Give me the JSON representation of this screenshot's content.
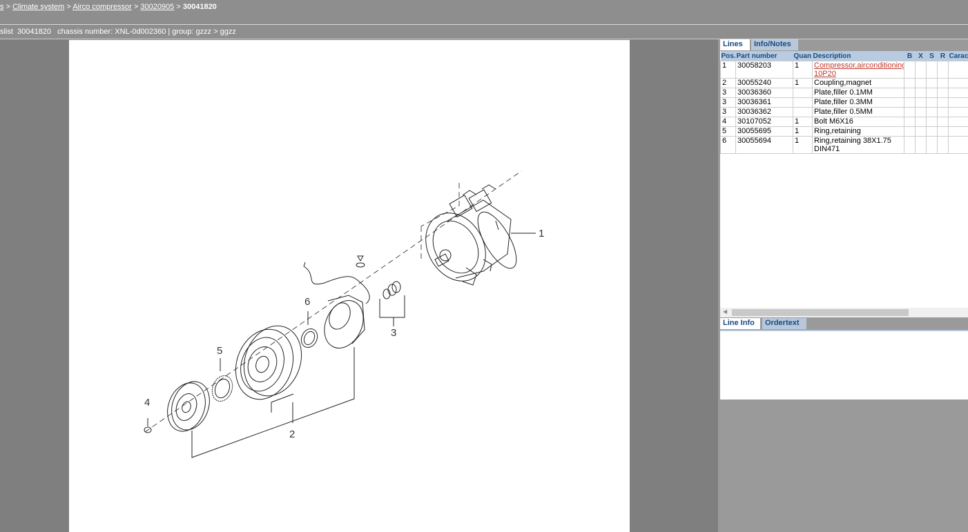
{
  "breadcrumb": {
    "items": [
      "s",
      "Climate system",
      "Airco compressor",
      "30020905"
    ],
    "current": "30041820",
    "separator": ">"
  },
  "infobar": {
    "text": "slist  30041820   chassis number: XNL-0d002360 | group: gzzz > ggzz"
  },
  "drawing": {
    "callouts": [
      "1",
      "2",
      "3",
      "4",
      "5",
      "6"
    ]
  },
  "tabs_top": [
    {
      "label": "Lines",
      "active": true
    },
    {
      "label": "Info/Notes",
      "active": false
    }
  ],
  "columns": [
    "Pos.",
    "Part number",
    "Quan",
    "Description",
    "B",
    "X",
    "S",
    "R",
    "Caract"
  ],
  "rows": [
    {
      "pos": "1",
      "part": "30058203",
      "qty": "1",
      "desc": "Compressor,airconditioning",
      "desc2": "10P20",
      "link": true
    },
    {
      "pos": "2",
      "part": "30055240",
      "qty": "1",
      "desc": "Coupling,magnet",
      "desc2": "",
      "link": false
    },
    {
      "pos": "3",
      "part": "30036360",
      "qty": "",
      "desc": "Plate,filler 0.1MM",
      "desc2": "",
      "link": false
    },
    {
      "pos": "3",
      "part": "30036361",
      "qty": "",
      "desc": "Plate,filler 0.3MM",
      "desc2": "",
      "link": false
    },
    {
      "pos": "3",
      "part": "30036362",
      "qty": "",
      "desc": "Plate,filler 0.5MM",
      "desc2": "",
      "link": false
    },
    {
      "pos": "4",
      "part": "30107052",
      "qty": "1",
      "desc": "Bolt M6X16",
      "desc2": "",
      "link": false
    },
    {
      "pos": "5",
      "part": "30055695",
      "qty": "1",
      "desc": "Ring,retaining",
      "desc2": "",
      "link": false
    },
    {
      "pos": "6",
      "part": "30055694",
      "qty": "1",
      "desc": "Ring,retaining 38X1.75",
      "desc2": "DIN471",
      "link": false
    }
  ],
  "tabs_bottom": [
    {
      "label": "Line Info",
      "active": true
    },
    {
      "label": "Ordertext",
      "active": false
    }
  ],
  "colors": {
    "background": "#7f7f7f",
    "tab_text": "#1a4a80",
    "header_bg": "#b8cbe0",
    "link": "#c0392b"
  }
}
